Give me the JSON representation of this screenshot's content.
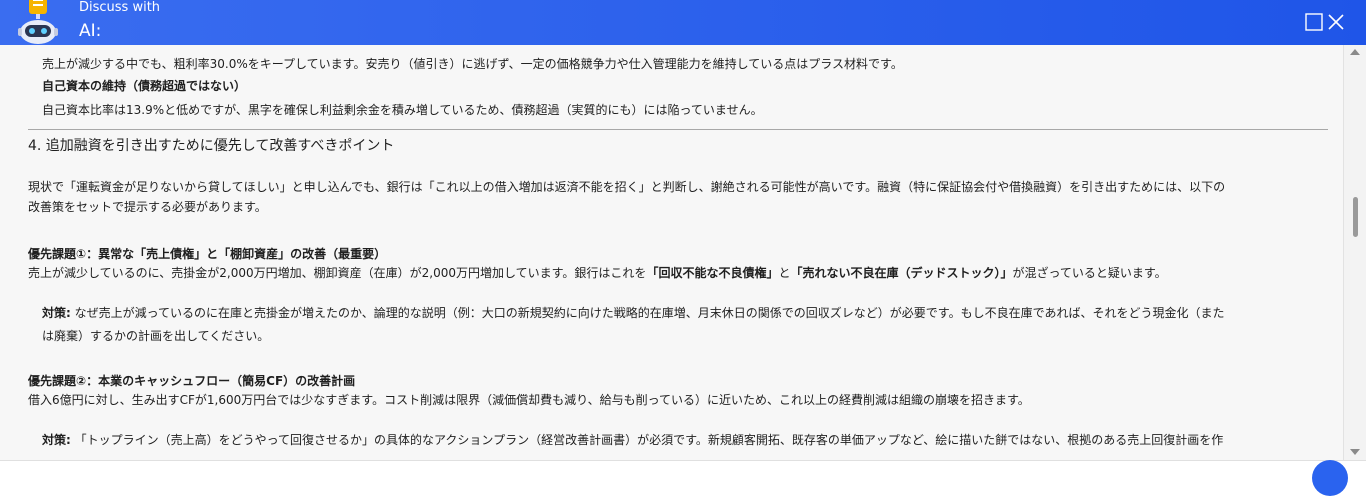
{
  "header": {
    "title_line1": "Discuss with",
    "title_line2": "AI:",
    "accent": "#2458ec"
  },
  "content": {
    "line_top": "売上が減少する中でも、粗利率30.0%をキープしています。安売り（値引き）に逃げず、一定の価格競争力や仕入管理能力を維持している点はプラス材料です。",
    "sub_heading": "自己資本の維持（債務超過ではない）",
    "sub_text": "自己資本比率は13.9%と低めですが、黒字を確保し利益剰余金を積み増しているため、債務超過（実質的にも）には陥っていません。",
    "section_heading": "4. 追加融資を引き出すために優先して改善すべきポイント",
    "intro_1": "現状で「運転資金が足りないから貸してほしい」と申し込んでも、銀行は「これ以上の借入増加は返済不能を招く」と判断し、謝絶される可能性が高いです。融資（特に保証協会付や借換融資）を引き出すためには、以下の",
    "intro_2": "改善策をセットで提示する必要があります。",
    "p1_heading": "優先課題①：異常な「売上債権」と「棚卸資産」の改善（最重要）",
    "p1_text_a": "売上が減少しているのに、売掛金が2,000万円増加、棚卸資産（在庫）が2,000万円増加しています。銀行はこれを",
    "p1_text_b": "「回収不能な不良債権」",
    "p1_text_c": "と",
    "p1_text_d": "「売れない不良在庫（デッドストック）」",
    "p1_text_e": "が混ざっていると疑います。",
    "p1_action_label": "対策:",
    "p1_action_1": " なぜ売上が減っているのに在庫と売掛金が増えたのか、論理的な説明（例：大口の新規契約に向けた戦略的在庫増、月末休日の関係での回収ズレなど）が必要です。もし不良在庫であれば、それをどう現金化（また",
    "p1_action_2": "は廃棄）するかの計画を出してください。",
    "p2_heading": "優先課題②：本業のキャッシュフロー（簡易CF）の改善計画",
    "p2_text": "借入6億円に対し、生み出すCFが1,600万円台では少なすぎます。コスト削減は限界（減価償却費も減り、給与も削っている）に近いため、これ以上の経費削減は組織の崩壊を招きます。",
    "p2_action_label": "対策:",
    "p2_action_1": " 「トップライン（売上高）をどうやって回復させるか」の具体的なアクションプラン（経営改善計画書）が必須です。新規顧客開拓、既存客の単価アップなど、絵に描いた餅ではない、根拠のある売上回復計画を作"
  },
  "icons": {
    "bot": "robot-avatar-icon",
    "maximize": "maximize-icon",
    "close": "close-icon"
  }
}
